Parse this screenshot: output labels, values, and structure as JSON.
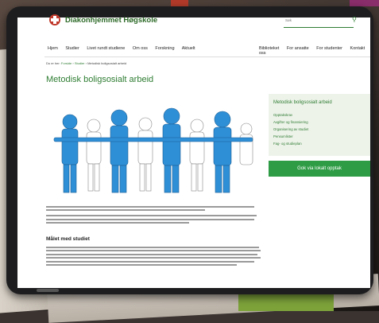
{
  "site": {
    "logo_text": "Diakonhjemmet Høgskole",
    "search_placeholder": "Søk"
  },
  "nav": {
    "left": [
      "Hjem",
      "Studier",
      "Livet rundt studiene",
      "Om oss",
      "Forskning",
      "Aktuelt"
    ],
    "right": [
      "Biblioteket",
      "For ansatte",
      "For studenter",
      "Kontakt oss"
    ]
  },
  "breadcrumb": {
    "prefix": "Du er her:",
    "items": [
      "Forside",
      "Studier",
      "Metodisk boligsosialt arbeid"
    ]
  },
  "page": {
    "title": "Metodisk boligsosialt arbeid",
    "section_heading": "Målet med studiet"
  },
  "sidebar": {
    "title": "Metodisk boligsosialt arbeid",
    "links": [
      "Opptakskrav",
      "Avgifter og finansiering",
      "Organisering av studiet",
      "Pensumlister",
      "Fag- og studieplan"
    ],
    "cta_label": "Gok via lokalt opptak"
  },
  "colors": {
    "accent_green": "#2e7d32",
    "cta_green": "#2e9c45",
    "logo_red": "#c0392b",
    "hero_blue": "#2f8fd6"
  }
}
